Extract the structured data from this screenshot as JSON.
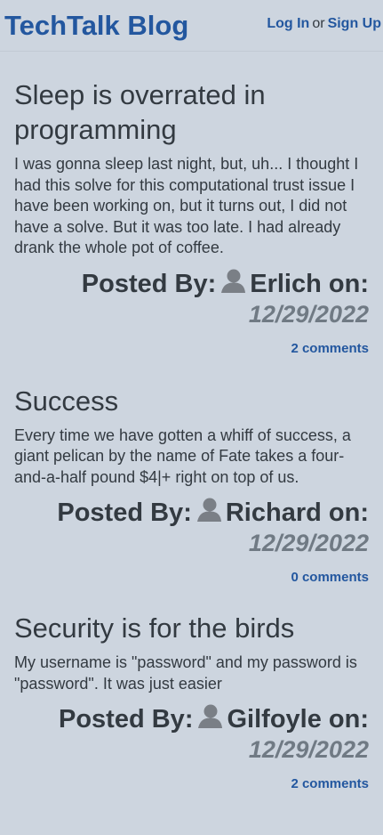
{
  "header": {
    "brand": "TechTalk Blog",
    "login_label": "Log In",
    "separator": "or",
    "signup_label": "Sign Up"
  },
  "posts": [
    {
      "title": "Sleep is overrated in programming",
      "body": "I was gonna sleep last night, but, uh... I thought I had this solve for this computational trust issue I have been working on, but it turns out, I did not have a solve. But it was too late. I had already drank the whole pot of coffee.",
      "posted_by_prefix": "Posted By:",
      "author": "Erlich",
      "on_label": "on:",
      "date": "12/29/2022",
      "comments": "2 comments"
    },
    {
      "title": "Success",
      "body": "Every time we have gotten a whiff of success, a giant pelican by the name of Fate takes a four-and-a-half pound $4|+ right on top of us.",
      "posted_by_prefix": "Posted By:",
      "author": "Richard",
      "on_label": "on:",
      "date": "12/29/2022",
      "comments": "0 comments"
    },
    {
      "title": "Security is for the birds",
      "body": "My username is \"password\" and my password is \"password\". It was just easier",
      "posted_by_prefix": "Posted By:",
      "author": "Gilfoyle",
      "on_label": "on:",
      "date": "12/29/2022",
      "comments": "2 comments"
    }
  ],
  "icons": {
    "author": "user-silhouette-icon"
  },
  "colors": {
    "background": "#cdd5df",
    "brand": "#23579f",
    "link": "#23579f",
    "text": "#333a41",
    "date": "#707a84",
    "icon": "#7a7f86"
  }
}
